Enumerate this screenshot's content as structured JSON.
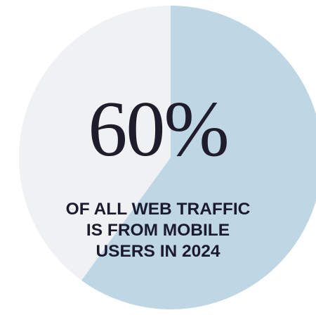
{
  "stat": {
    "value_text": "60%",
    "caption_lines": [
      "OF ALL WEB TRAFFIC",
      "IS FROM MOBILE",
      "USERS IN 2024"
    ]
  },
  "colors": {
    "mobile_slice": "#bfd6e5",
    "other_slice": "#f0f1f3",
    "text": "#1f1c2c",
    "background": "#ffffff"
  },
  "chart_data": {
    "type": "pie",
    "values": [
      60,
      40
    ],
    "unit": "%",
    "title": "",
    "annotations": [
      "60%",
      "OF ALL WEB TRAFFIC IS FROM MOBILE USERS IN 2024"
    ],
    "legend": "none",
    "grid": false
  }
}
